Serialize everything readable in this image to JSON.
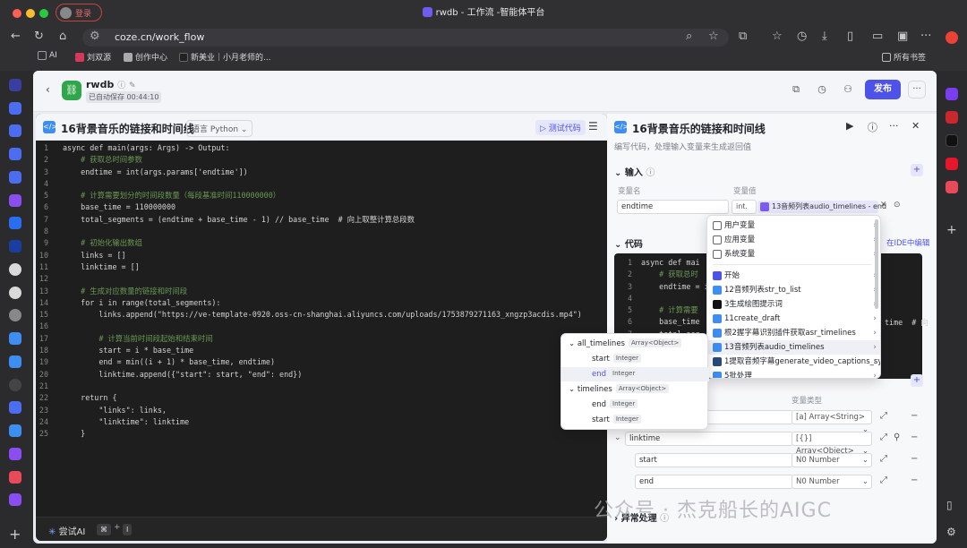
{
  "browser": {
    "login_label": "登录",
    "window_title": "rwdb - 工作流 -智能体平台",
    "url": "coze.cn/work_flow",
    "bookmarks": [
      {
        "label": "AI",
        "color": "#9aa0aa"
      },
      {
        "label": "刘双源",
        "color": "#d6385a"
      },
      {
        "label": "创作中心",
        "color": "#aaaaaa"
      },
      {
        "label": "新美业｜小月老师的...",
        "color": "#222222"
      }
    ],
    "all_bookmarks_label": "所有书签"
  },
  "header": {
    "workflow_name": "rwdb",
    "autosave": "已自动保存 00:44:10",
    "publish_label": "发布",
    "more_label": "···"
  },
  "editor": {
    "title": "16背景音乐的链接和时间线",
    "language": "语言 Python",
    "test_label": "测试代码",
    "lines": [
      {
        "n": "1",
        "t": "async def main(args: Args) -> Output:",
        "c": false
      },
      {
        "n": "2",
        "t": "    # 获取总时间参数",
        "c": true
      },
      {
        "n": "3",
        "t": "    endtime = int(args.params['endtime'])",
        "c": false
      },
      {
        "n": "4",
        "t": "",
        "c": false
      },
      {
        "n": "5",
        "t": "    # 计算需要划分的时间段数量（每段基准时间110000000）",
        "c": true
      },
      {
        "n": "6",
        "t": "    base_time = 110000000",
        "c": false
      },
      {
        "n": "7",
        "t": "    total_segments = (endtime + base_time - 1) // base_time  # 向上取整计算总段数",
        "c": false
      },
      {
        "n": "8",
        "t": "",
        "c": false
      },
      {
        "n": "9",
        "t": "    # 初始化输出数组",
        "c": true
      },
      {
        "n": "10",
        "t": "    links = []",
        "c": false
      },
      {
        "n": "11",
        "t": "    linktime = []",
        "c": false
      },
      {
        "n": "12",
        "t": "",
        "c": false
      },
      {
        "n": "13",
        "t": "    # 生成对应数量的链接和时间段",
        "c": true
      },
      {
        "n": "14",
        "t": "    for i in range(total_segments):",
        "c": false
      },
      {
        "n": "15",
        "t": "        links.append(\"https://ve-template-0920.oss-cn-shanghai.aliyuncs.com/uploads/1753879271163_xngzp3acdis.mp4\")",
        "c": false
      },
      {
        "n": "16",
        "t": "",
        "c": false
      },
      {
        "n": "17",
        "t": "        # 计算当前时间段起始和结束时间",
        "c": true
      },
      {
        "n": "18",
        "t": "        start = i * base_time",
        "c": false
      },
      {
        "n": "19",
        "t": "        end = min((i + 1) * base_time, endtime)",
        "c": false
      },
      {
        "n": "20",
        "t": "        linktime.append({\"start\": start, \"end\": end})",
        "c": false
      },
      {
        "n": "21",
        "t": "",
        "c": false
      },
      {
        "n": "22",
        "t": "    return {",
        "c": false
      },
      {
        "n": "23",
        "t": "        \"links\": links,",
        "c": false
      },
      {
        "n": "24",
        "t": "        \"linktime\": linktime",
        "c": false
      },
      {
        "n": "25",
        "t": "    }",
        "c": false
      }
    ],
    "try_ai_label": "尝试AI",
    "kbd_cmd": "⌘",
    "kbd_plus": "+",
    "kbd_i": "I"
  },
  "side_panel": {
    "title": "16背景音乐的链接和时间线",
    "desc": "编写代码，处理输入变量来生成返回值",
    "input_section": "输入",
    "col_var_name": "变量名",
    "col_var_value": "变量值",
    "input_name": "endtime",
    "input_type": "int.",
    "input_ref": "13音频列表audio_timelines - end",
    "code_section": "代码",
    "edit_in_ide": "在IDE中编辑",
    "mini_code": [
      {
        "n": "1",
        "t": "async def mai",
        "c": false
      },
      {
        "n": "2",
        "t": "    # 获取总时",
        "c": true
      },
      {
        "n": "3",
        "t": "    endtime = i",
        "c": false
      },
      {
        "n": "4",
        "t": "",
        "c": false
      },
      {
        "n": "5",
        "t": "    # 计算需要",
        "c": true
      },
      {
        "n": "6",
        "t": "    base_time",
        "c": false
      },
      {
        "n": "7",
        "t": "    total_seg",
        "c": false
      }
    ],
    "mini_code_tail": "time  # 向",
    "col_var_type": "变量类型",
    "outputs": [
      {
        "name": "",
        "type": "Array<String>",
        "type_icon": "[a]"
      },
      {
        "name": "linktime",
        "type": "Array<Object>",
        "type_icon": "[{}]"
      },
      {
        "name": "start",
        "type": "Number",
        "type_icon": "N0"
      },
      {
        "name": "end",
        "type": "Number",
        "type_icon": "N0"
      }
    ],
    "exception_label": "异常处理"
  },
  "dropdown": {
    "groups": [
      {
        "label": "用户变量",
        "icon": "person"
      },
      {
        "label": "应用变量",
        "icon": "folder"
      },
      {
        "label": "系统变量",
        "icon": "folder"
      }
    ],
    "nodes": [
      {
        "label": "开始",
        "color": "#4d53e8"
      },
      {
        "label": "12音频列表str_to_list",
        "color": "#3d8ef0"
      },
      {
        "label": "3生成绘图提示词",
        "color": "#111111"
      },
      {
        "label": "11create_draft",
        "color": "#3d8ef0"
      },
      {
        "label": "根2握字幕识别插件获取asr_timelines",
        "color": "#3d8ef0"
      },
      {
        "label": "13音频列表audio_timelines",
        "color": "#3d8ef0"
      },
      {
        "label": "1提取音频字幕generate_video_captions_sync",
        "color": "#2a4a7a"
      },
      {
        "label": "5批处理",
        "color": "#3d8ef0"
      }
    ]
  },
  "subdropdown": {
    "groups": [
      {
        "label": "all_timelines",
        "type": "Array<Object>",
        "children": [
          {
            "label": "start",
            "type": "Integer"
          },
          {
            "label": "end",
            "type": "Integer"
          }
        ]
      },
      {
        "label": "timelines",
        "type": "Array<Object>",
        "children": [
          {
            "label": "end",
            "type": "Integer"
          },
          {
            "label": "start",
            "type": "Integer"
          }
        ]
      }
    ]
  },
  "watermark": "公众号 · 杰克船长的AIGC",
  "colors": {
    "accent": "#4d53e8",
    "code_bg": "#1e1e1e",
    "comment": "#6a9955"
  }
}
